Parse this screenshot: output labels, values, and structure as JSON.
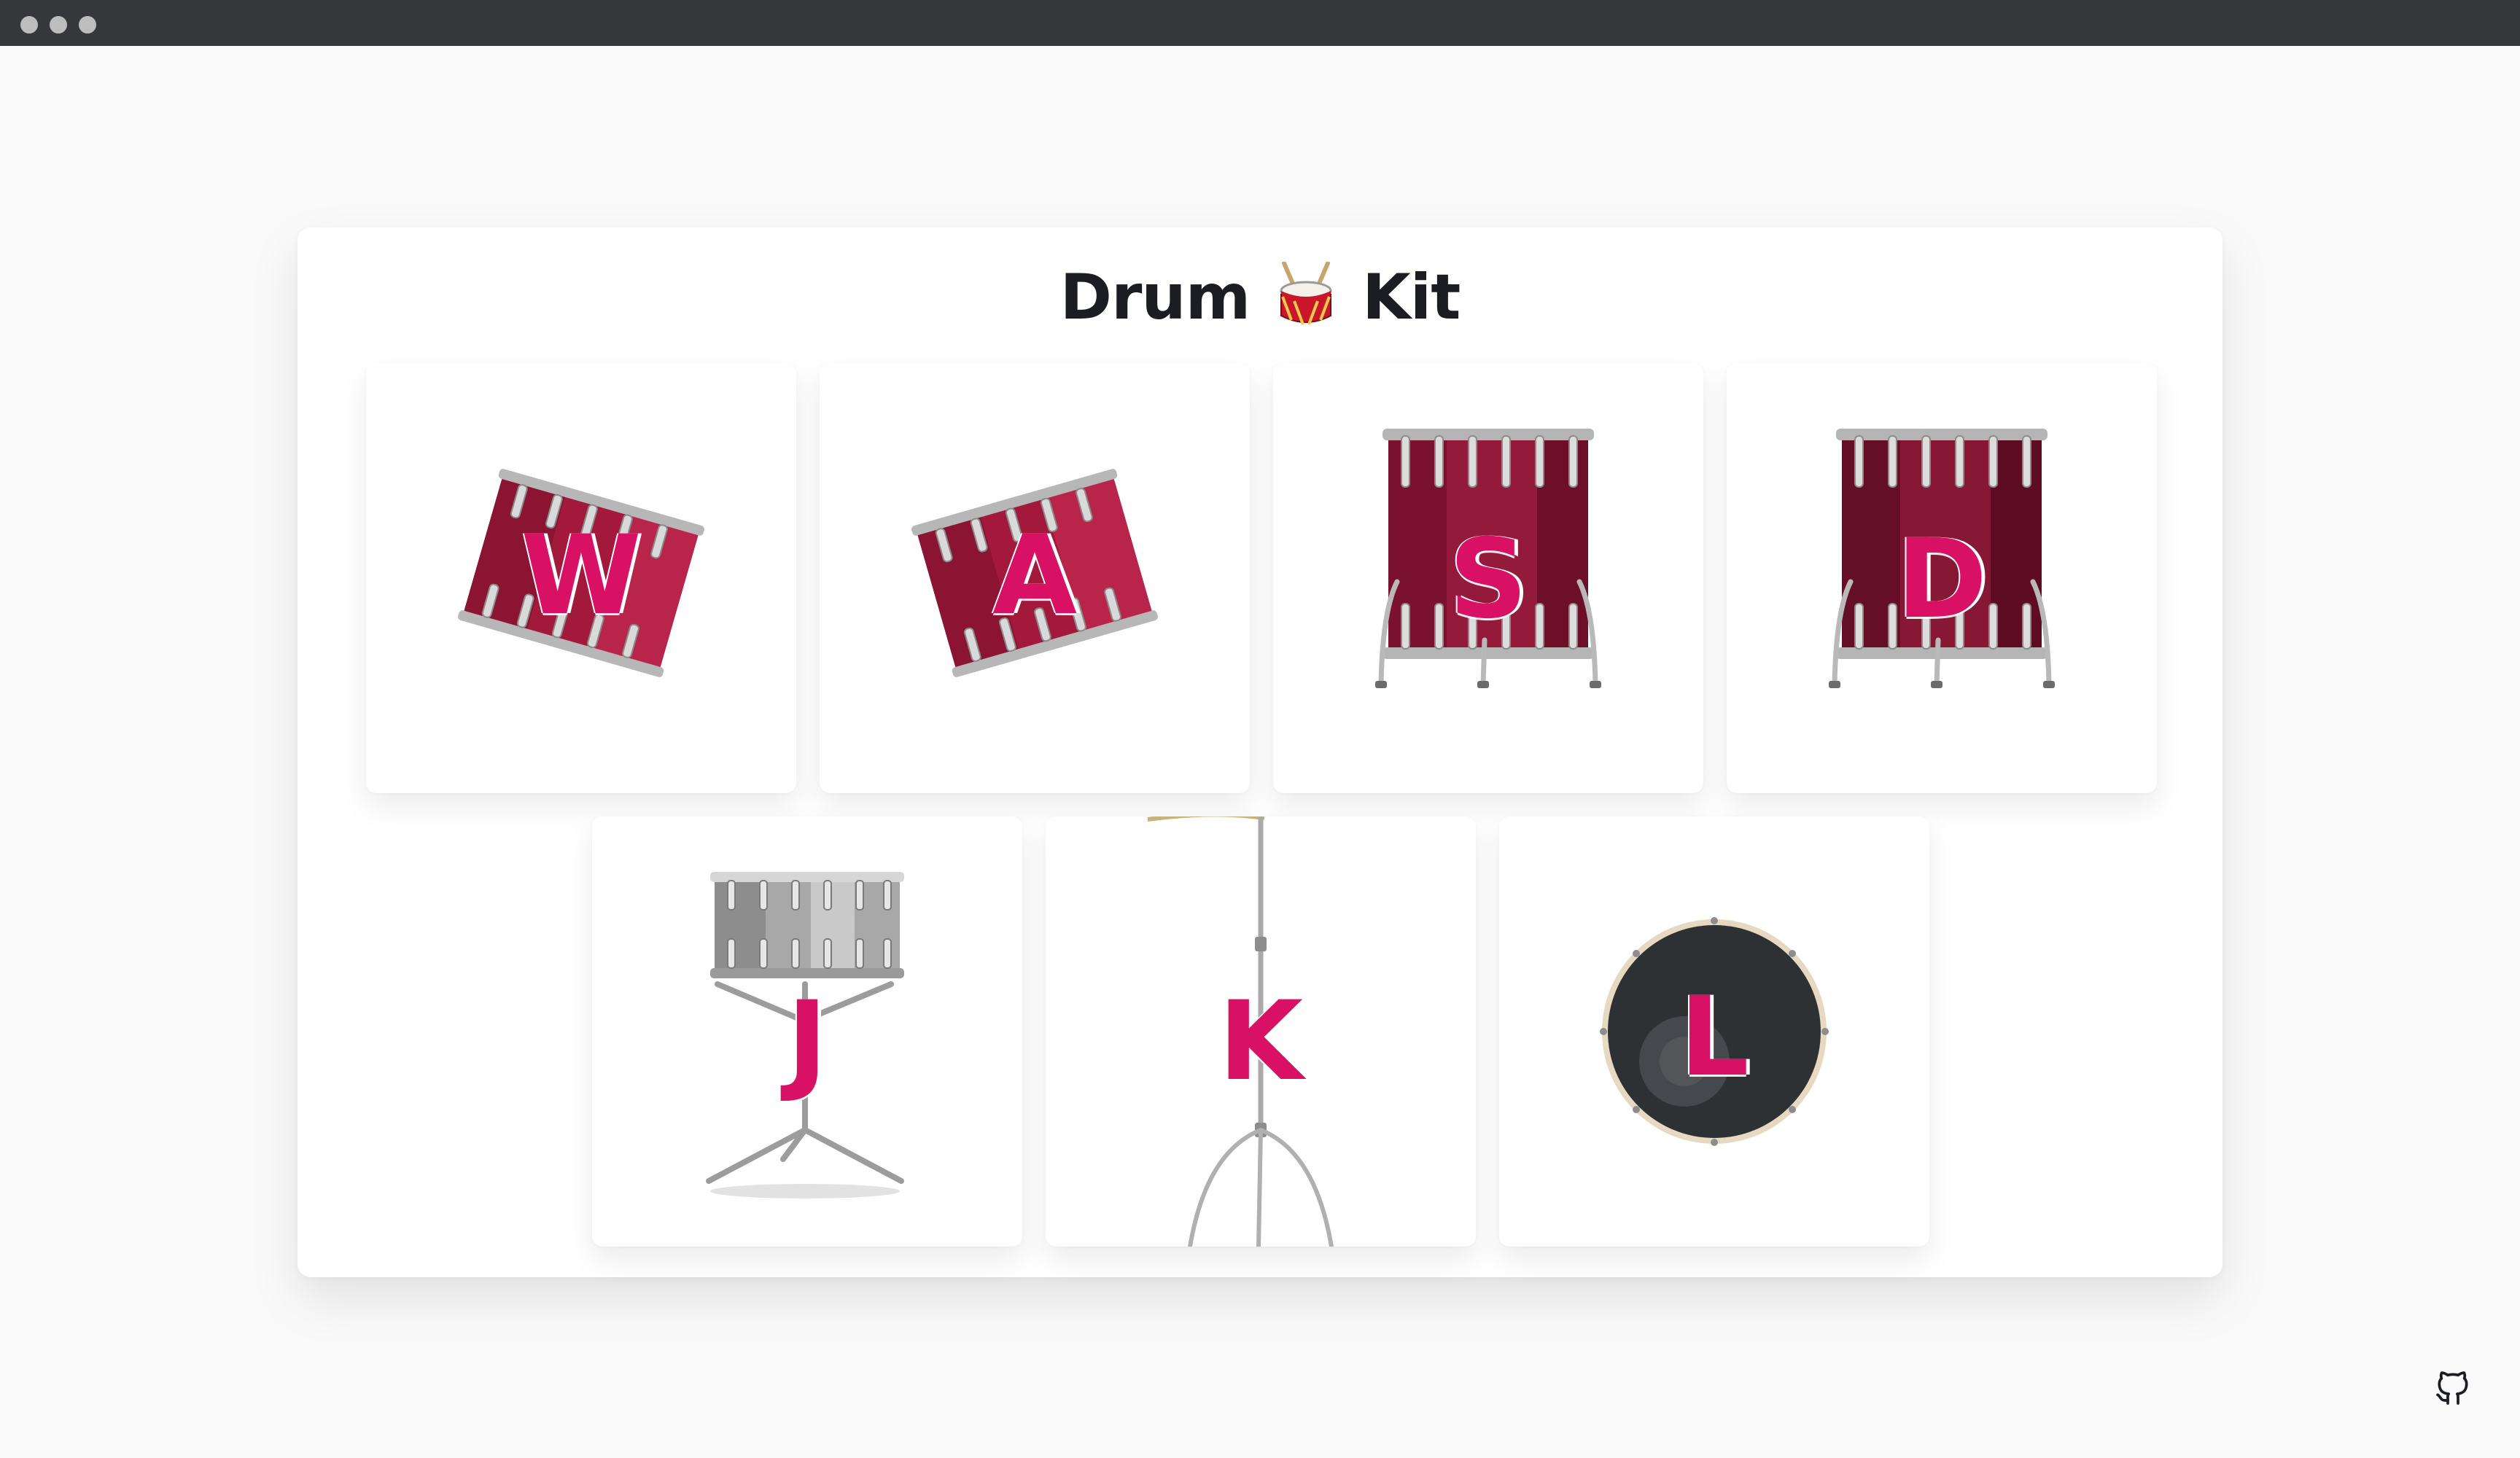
{
  "window": {
    "controls": [
      "close",
      "minimize",
      "maximize"
    ]
  },
  "title": {
    "before": "Drum",
    "emoji_icon": "drum-emoji-icon",
    "after": "Kit"
  },
  "pads": [
    {
      "key": "W",
      "instrument_icon": "tom-drum-icon"
    },
    {
      "key": "A",
      "instrument_icon": "tom-drum-icon"
    },
    {
      "key": "S",
      "instrument_icon": "floor-tom-icon"
    },
    {
      "key": "D",
      "instrument_icon": "floor-tom-icon"
    },
    {
      "key": "J",
      "instrument_icon": "snare-drum-icon"
    },
    {
      "key": "K",
      "instrument_icon": "cymbal-stand-icon"
    },
    {
      "key": "L",
      "instrument_icon": "kick-drum-icon"
    }
  ],
  "footer": {
    "link_icon": "github-icon"
  },
  "colors": {
    "accent": "#d81165",
    "drum_red": "#9b1b3a",
    "background": "#fafafa",
    "titlebar": "#36373a"
  }
}
